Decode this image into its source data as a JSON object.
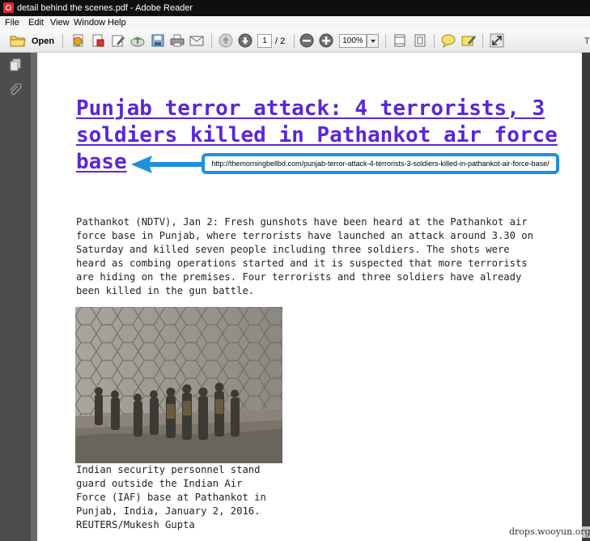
{
  "window": {
    "title": "detail behind the scenes.pdf - Adobe Reader"
  },
  "menubar": {
    "items": [
      "File",
      "Edit",
      "View",
      "Window",
      "Help"
    ]
  },
  "toolbar": {
    "open_label": "Open",
    "page_current": "1",
    "page_total": "/ 2",
    "zoom": "100%",
    "extra": "T"
  },
  "icons": [
    "open-folder-icon",
    "create-pdf-icon",
    "convert-icon",
    "sign-icon",
    "upload-icon",
    "save-icon",
    "print-icon",
    "email-icon",
    "page-up-icon",
    "page-down-icon",
    "zoom-out-icon",
    "zoom-in-icon",
    "fit-page-icon",
    "full-page-icon",
    "comment-icon",
    "highlight-icon",
    "expand-icon",
    "pages-icon",
    "attachment-icon"
  ],
  "document": {
    "headline": {
      "lines": [
        "Punjab terror attack: 4 terrorists, 3",
        "soldiers killed in Pathankot air force",
        "base"
      ],
      "color": "#5a26d8"
    },
    "source_url": "http://themorningbellbd.com/punjab-terror-attack-4-terrorists-3-soldiers-killed-in-pathankot-air-force-base/",
    "callout_color": "#1f8fe0",
    "body_lines": [
      "Pathankot (NDTV), Jan 2: Fresh gunshots have been heard at the Pathankot air",
      "force base in Punjab, where terrorists have launched an attack around 3.30 on",
      "Saturday and killed seven people including three soldiers. The shots were",
      "heard as combing operations started and it is suspected that more terrorists",
      "are hiding on the premises. Four terrorists and three soldiers have already",
      "been killed in the gun battle."
    ],
    "caption_lines": [
      "Indian security personnel stand",
      "guard outside the Indian Air",
      "Force (IAF) base at Pathankot in",
      "Punjab, India, January 2, 2016.",
      "REUTERS/Mukesh Gupta"
    ]
  },
  "watermark": "drops.wooyun.org"
}
